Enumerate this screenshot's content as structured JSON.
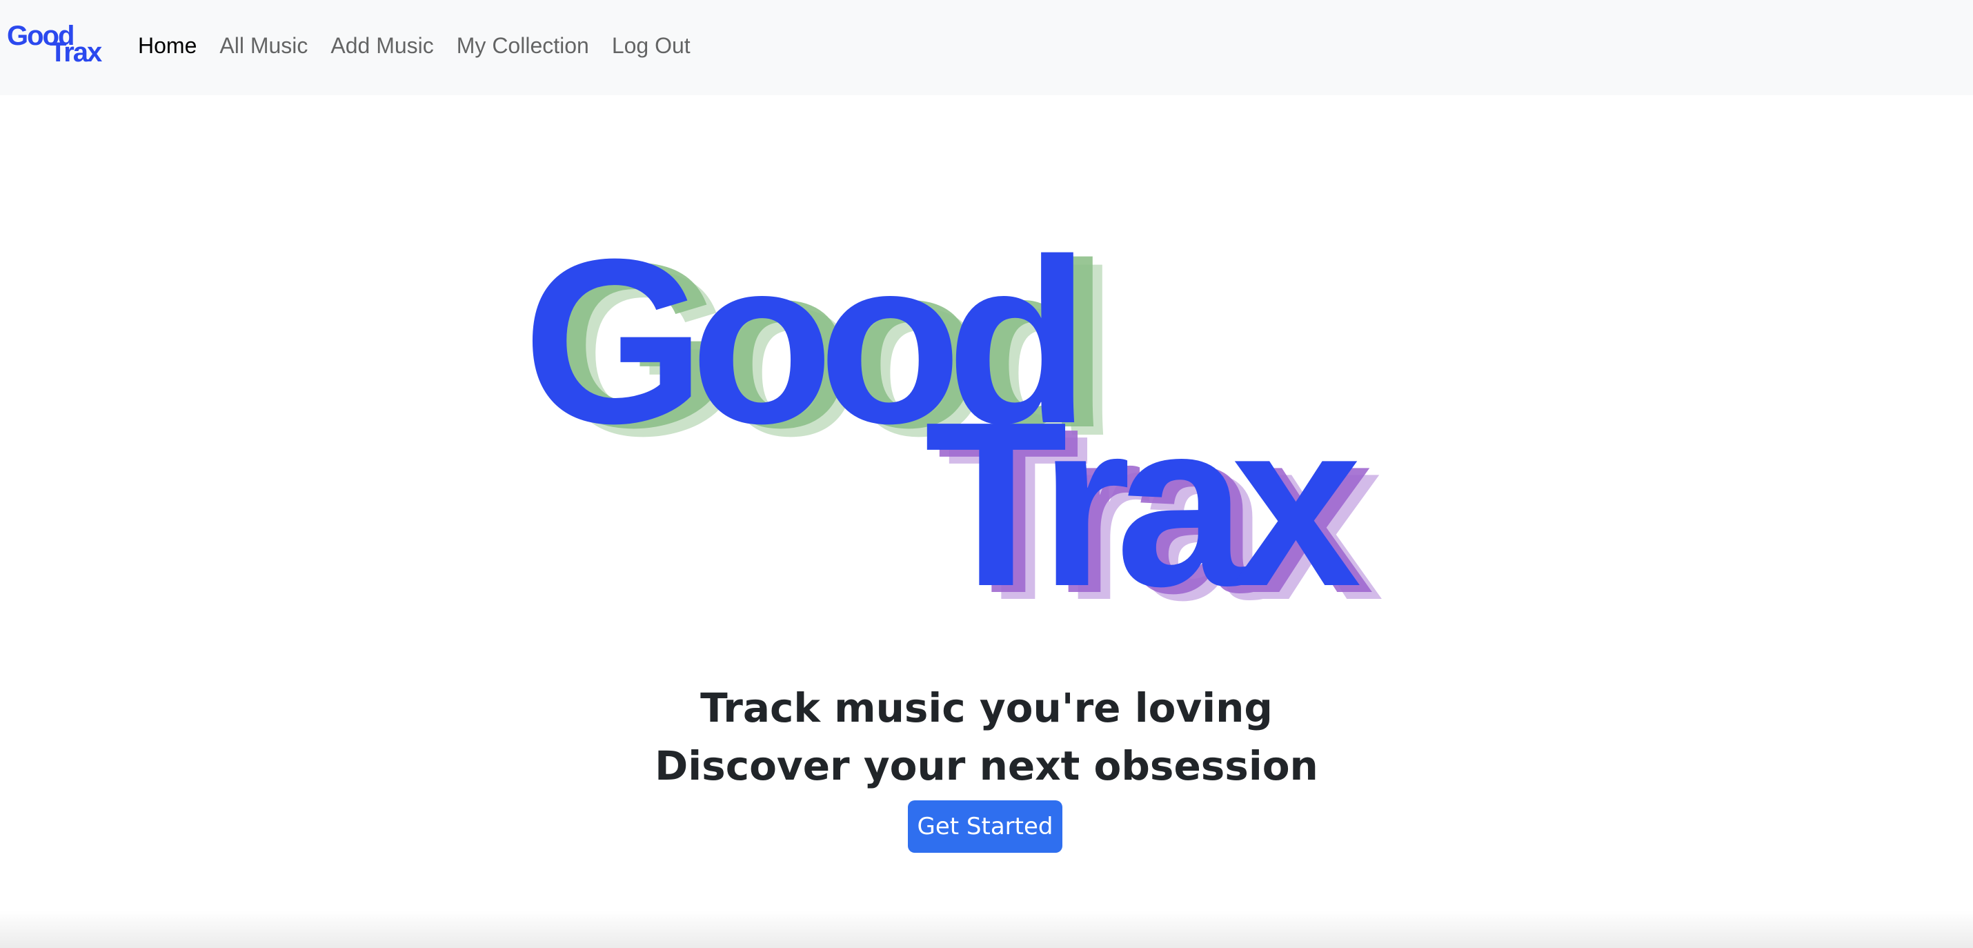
{
  "brand": {
    "word1": "Good",
    "word2": "Trax",
    "color": "#2b49ee",
    "shadow_green": "#8ec08a",
    "shadow_purple": "#a06ad0"
  },
  "nav": {
    "items": [
      {
        "label": "Home",
        "active": true
      },
      {
        "label": "All Music",
        "active": false
      },
      {
        "label": "Add Music",
        "active": false
      },
      {
        "label": "My Collection",
        "active": false
      },
      {
        "label": "Log Out",
        "active": false
      }
    ]
  },
  "hero": {
    "tagline_line1": "Track music you're loving",
    "tagline_line2": "Discover your next obsession",
    "cta_label": "Get Started",
    "cta_color": "#2f6fef"
  }
}
